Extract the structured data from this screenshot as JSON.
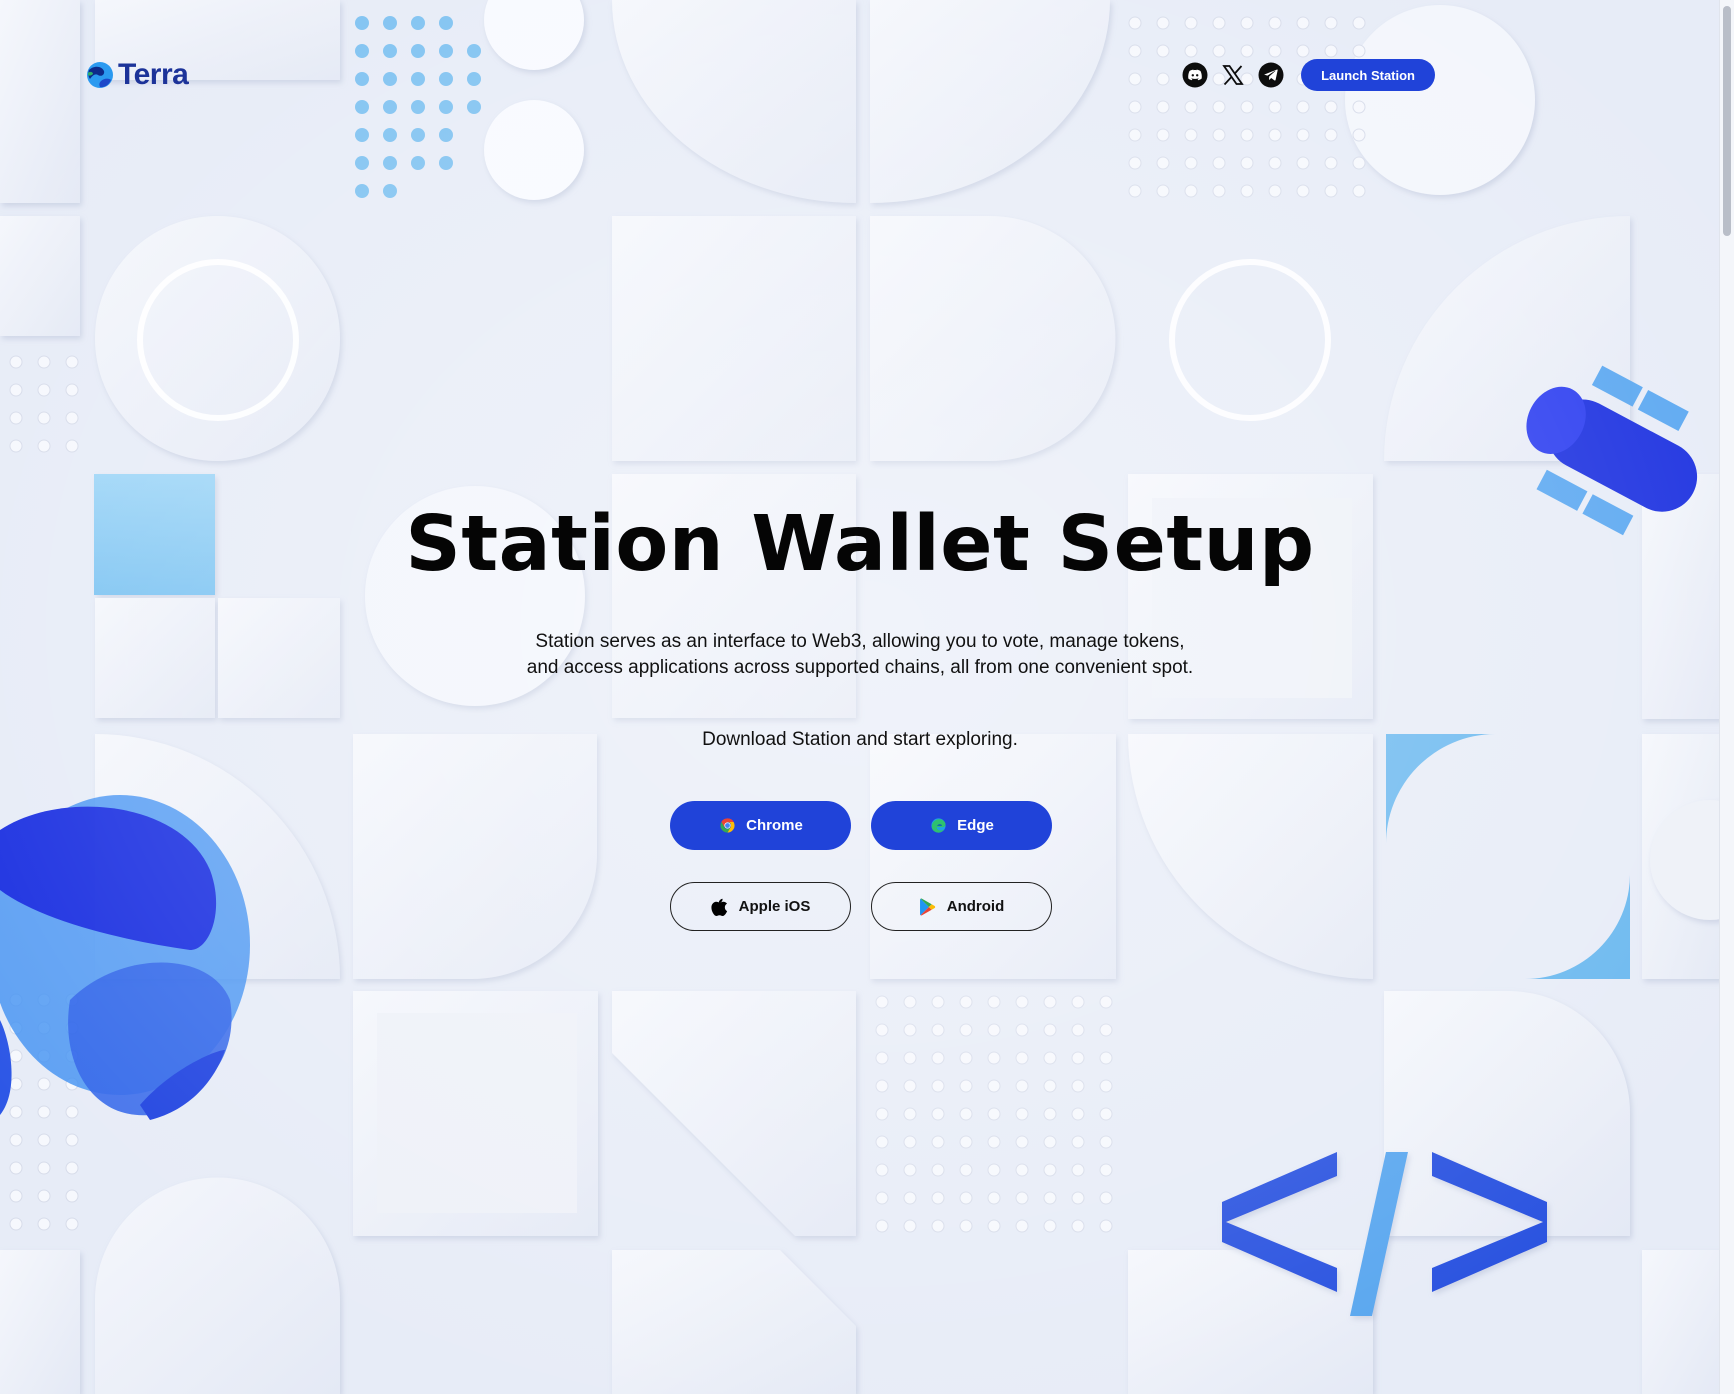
{
  "brand": {
    "name": "Terra"
  },
  "header": {
    "social": [
      {
        "icon": "discord-icon"
      },
      {
        "icon": "x-icon"
      },
      {
        "icon": "telegram-icon"
      }
    ],
    "launch_label": "Launch Station"
  },
  "hero": {
    "title": "Station Wallet Setup",
    "description_line1": "Station serves as an interface to Web3, allowing you to vote, manage tokens,",
    "description_line2": "and access applications across supported chains, all from one convenient spot.",
    "cta": "Download Station and start exploring."
  },
  "downloads": {
    "chrome": {
      "label": "Chrome",
      "icon": "chrome-icon"
    },
    "edge": {
      "label": "Edge",
      "icon": "edge-icon"
    },
    "ios": {
      "label": "Apple iOS",
      "icon": "apple-icon"
    },
    "android": {
      "label": "Android",
      "icon": "google-play-icon"
    }
  },
  "colors": {
    "primary": "#2043d9",
    "brand_text": "#1c3399",
    "background": "#e6ebf6",
    "accent_light": "#8fd0f5"
  }
}
